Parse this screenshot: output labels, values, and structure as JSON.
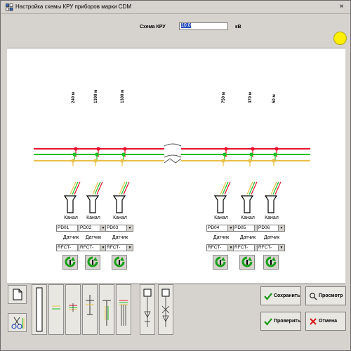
{
  "window": {
    "title": "Настройка схемы КРУ приборов марки CDM",
    "close": "×"
  },
  "header": {
    "kru_label": "Схема КРУ",
    "kru_value": "10.0",
    "unit": "кВ"
  },
  "lengths": [
    "240 м",
    "1300 м",
    "1300 м",
    "750 м",
    "370 м",
    "50 м"
  ],
  "channels": [
    {
      "kanal": "Канал",
      "datchik": "Датчик",
      "pd": "PD01",
      "sensor": "RFCT-"
    },
    {
      "kanal": "Канал",
      "datchik": "Датчик",
      "pd": "PD02",
      "sensor": "RFCT-"
    },
    {
      "kanal": "Канал",
      "datchik": "Датчик",
      "pd": "PD03",
      "sensor": "RFCT-"
    },
    {
      "kanal": "Канал",
      "datchik": "Датчик",
      "pd": "PD04",
      "sensor": "RFCT-"
    },
    {
      "kanal": "Канал",
      "datchik": "Датчик",
      "pd": "PD05",
      "sensor": "RFCT-"
    },
    {
      "kanal": "Канал",
      "datchik": "Датчик",
      "pd": "PD06",
      "sensor": "RFCT-"
    }
  ],
  "buttons": {
    "save": "Сохранить",
    "preview": "Просмотр",
    "check": "Проверить",
    "cancel": "Отмена"
  },
  "colors": {
    "phase_red": "#e8102a",
    "phase_green": "#19c020",
    "phase_yellow": "#e8c048",
    "status": "#ffef00"
  }
}
